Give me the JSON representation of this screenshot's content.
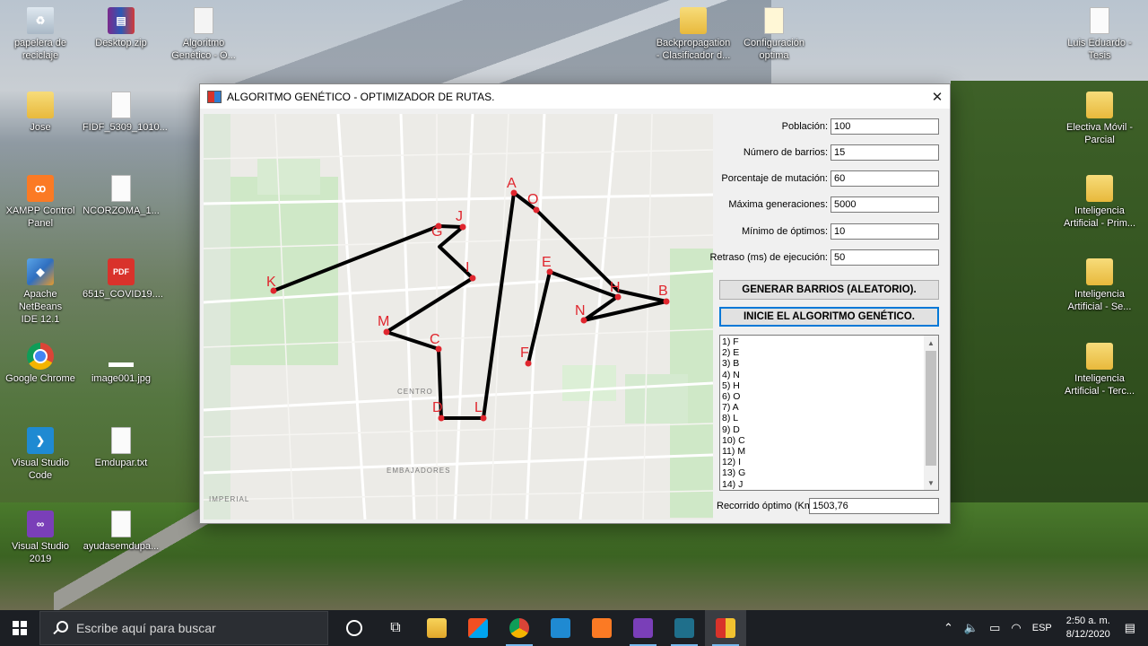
{
  "desktop": {
    "icons": [
      {
        "label": "papelera de\nreciclaje",
        "x": 0,
        "kind": "recycle"
      },
      {
        "label": "Desktop.zip",
        "kind": "zip"
      },
      {
        "label": "Algoritmo\nGenético - O...",
        "kind": "doc"
      },
      {
        "label": "Backpropagation\n- Clasificador d...",
        "kind": "folder"
      },
      {
        "label": "Configuración\noptima",
        "kind": "doc"
      },
      {
        "label": "Luis Eduardo -\nTesis",
        "kind": "doc"
      },
      {
        "label": "Jose",
        "kind": "folder"
      },
      {
        "label": "FIDF_5309_1010...",
        "kind": "doc"
      },
      {
        "label": "Electiva Móvil -\nParcial",
        "kind": "folder"
      },
      {
        "label": "XAMPP Control\nPanel",
        "kind": "xampp"
      },
      {
        "label": "NCORZOMA_1...",
        "kind": "doc"
      },
      {
        "label": "Inteligencia\nArtificial - Prim...",
        "kind": "folder"
      },
      {
        "label": "Apache NetBeans\nIDE 12.1",
        "kind": "netbeans"
      },
      {
        "label": "6515_COVID19....",
        "kind": "pdf"
      },
      {
        "label": "Inteligencia\nArtificial - Se...",
        "kind": "folder"
      },
      {
        "label": "Google Chrome",
        "kind": "chrome"
      },
      {
        "label": "image001.jpg",
        "kind": "img"
      },
      {
        "label": "Inteligencia\nArtificial - Terc...",
        "kind": "folder"
      },
      {
        "label": "Visual Studio\nCode",
        "kind": "vscode"
      },
      {
        "label": "Emdupar.txt",
        "kind": "doc"
      },
      {
        "label": "Visual Studio\n2019",
        "kind": "vs"
      },
      {
        "label": "ayudasemdupa...",
        "kind": "doc"
      }
    ]
  },
  "window": {
    "title": "ALGORITMO GENÉTICO - OPTIMIZADOR DE RUTAS.",
    "close": "✕"
  },
  "form": {
    "fields": [
      {
        "label": "Población:",
        "value": "100"
      },
      {
        "label": "Número de barrios:",
        "value": "15"
      },
      {
        "label": "Porcentaje de mutación:",
        "value": "60"
      },
      {
        "label": "Máxima generaciones:",
        "value": "5000"
      },
      {
        "label": "Mínimo de óptimos:",
        "value": "10"
      },
      {
        "label": "Retraso (ms) de ejecución:",
        "value": "50"
      }
    ],
    "btn_generate": "GENERAR BARRIOS (ALEATORIO).",
    "btn_start": "INICIE EL ALGORITMO GENÉTICO.",
    "route_list": [
      "1) F",
      "2) E",
      "3) B",
      "4) N",
      "5) H",
      "6) O",
      "7) A",
      "8) L",
      "9) D",
      "10) C",
      "11) M",
      "12) I",
      "13) G",
      "14) J"
    ],
    "result_label": "Recorrido óptimo (Km):",
    "result_value": "1503,76"
  },
  "map": {
    "district_labels": [
      "CENTRO",
      "EMBAJADORES",
      "IMPERIAL"
    ],
    "route_order": [
      "K",
      "G",
      "J",
      "I",
      "M",
      "C",
      "D",
      "L",
      "A",
      "O",
      "H",
      "B",
      "N",
      "E",
      "F"
    ]
  },
  "taskbar": {
    "search_placeholder": "Escribe aquí para buscar",
    "language": "ESP",
    "time": "2:50 a. m.",
    "date": "8/12/2020"
  }
}
